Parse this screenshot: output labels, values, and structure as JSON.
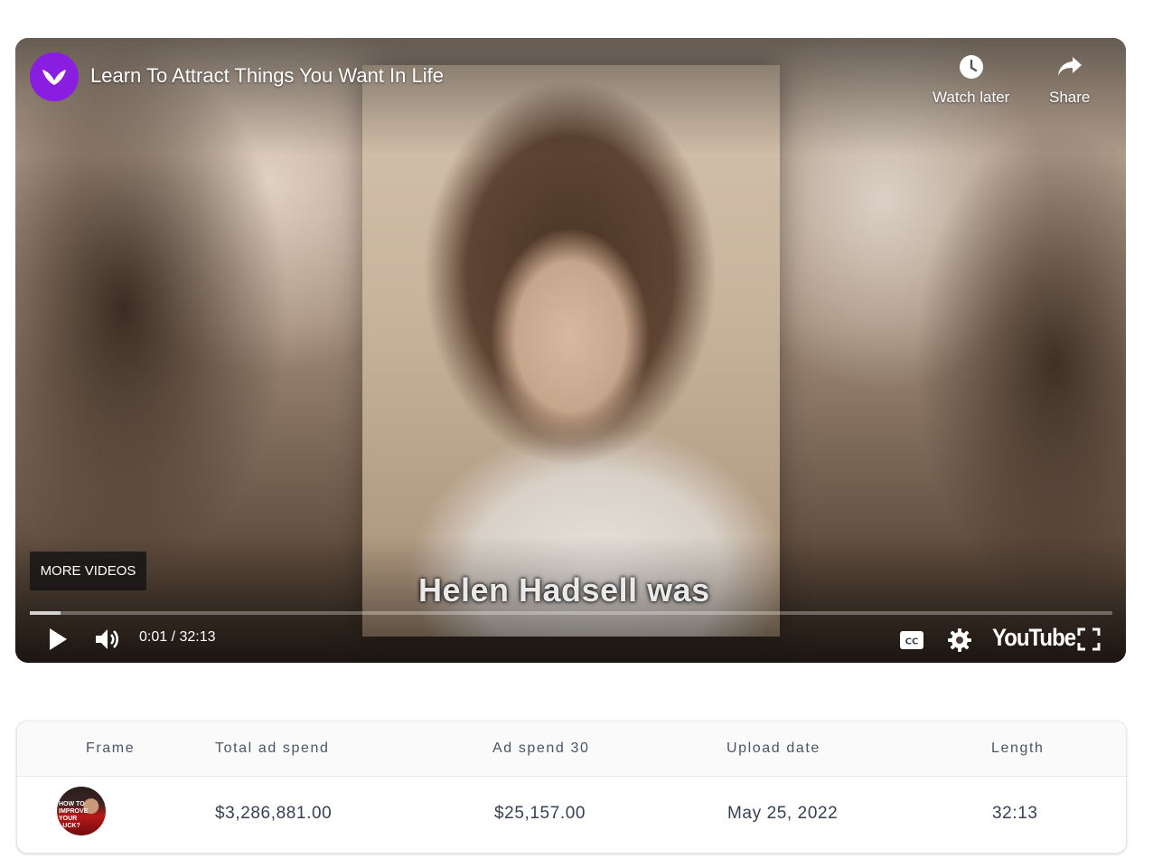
{
  "video": {
    "title": "Learn To Attract Things You Want In Life",
    "watch_later_label": "Watch later",
    "share_label": "Share",
    "more_videos_label": "MORE VIDEOS",
    "caption": "Helen Hadsell was",
    "time_display": "0:01 / 32:13",
    "progress_fraction": 0.028,
    "youtube_logo_text": "YouTube",
    "channel_logo_color": "#8a1ee0"
  },
  "table": {
    "headers": [
      "Frame",
      "Total ad spend",
      "Ad spend 30",
      "Upload date",
      "Length"
    ],
    "rows": [
      {
        "thumbnail_text": "HOW TO IMPROVE YOUR LUCK?",
        "total_ad_spend": "$3,286,881.00",
        "ad_spend_30": "$25,157.00",
        "upload_date": "May 25, 2022",
        "length": "32:13"
      }
    ]
  }
}
